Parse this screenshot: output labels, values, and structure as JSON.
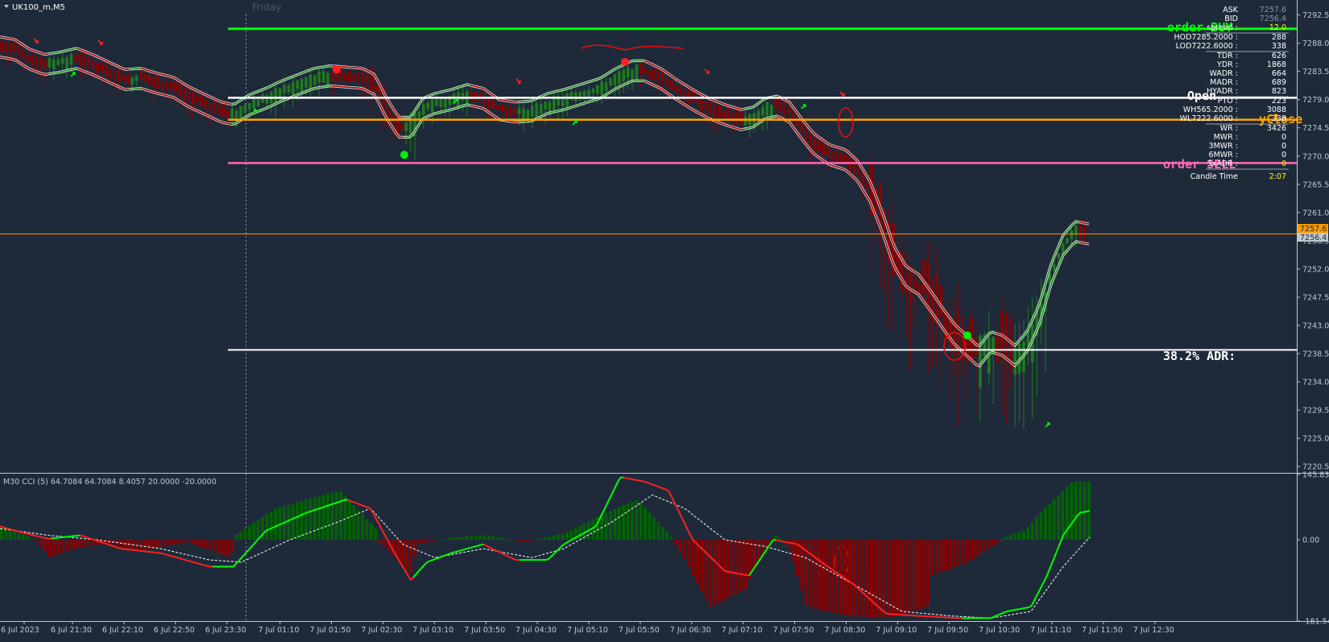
{
  "symbol_title": "UK100_m,M5",
  "session_label": "Friday",
  "colors": {
    "background": "#1e2a3a",
    "bull_candle": "#1f7a1f",
    "bear_candle": "#8b0000",
    "band_red": "#a00000",
    "band_green": "#1a8f1a",
    "order_buy": "#00ff00",
    "order_sell": "#ff69b4",
    "open_line": "#ffffff",
    "yclose_line": "#ffa500",
    "current_price": "#ff9900",
    "cci_up": "#006400",
    "cci_down": "#8b0000",
    "cci_fast": "#00ff00",
    "cci_slow": "#ff2020"
  },
  "labels": {
    "order_buy": "order BUY",
    "order_sell": "order SELL",
    "open": "Open",
    "yclose": "yClose",
    "adr": "38.2% ADR:"
  },
  "current_price_tags": [
    "7257.6",
    "7256.4"
  ],
  "info_panel": [
    {
      "label": "ASK",
      "value": "7257.6"
    },
    {
      "label": "BID",
      "value": "7256.4"
    },
    {
      "label": "spread :",
      "value": "12.0"
    },
    {
      "label": "HOD7285.2000 :",
      "value": "288"
    },
    {
      "label": "LOD7222.6000 :",
      "value": "338"
    },
    {
      "label": "TDR :",
      "value": "626"
    },
    {
      "label": "YDR :",
      "value": "1868"
    },
    {
      "label": "WADR :",
      "value": "664"
    },
    {
      "label": "MADR :",
      "value": "689"
    },
    {
      "label": "HYADR :",
      "value": "823"
    },
    {
      "label": "PTO :",
      "value": "223"
    },
    {
      "label": "WH565.2000 :",
      "value": "3088"
    },
    {
      "label": "WL7222.6000 :",
      "value": "338"
    },
    {
      "label": "WR :",
      "value": "3426"
    },
    {
      "label": "MWR :",
      "value": "0"
    },
    {
      "label": "3MWR :",
      "value": "0"
    },
    {
      "label": "6MWR :",
      "value": "0"
    },
    {
      "label": "3xADR :",
      "value": "0"
    },
    {
      "label": "Candle Time",
      "value": "2:07"
    }
  ],
  "cci_header": "M30 CCI (5) 64.7084 64.7084 8.4057 20.0000 -20.0000",
  "chart_data": [
    {
      "type": "candlestick",
      "title": "UK100_m,M5",
      "y_ticks": [
        "7292.5",
        "7288.0",
        "7283.5",
        "7279.0",
        "7274.5",
        "7270.0",
        "7265.5",
        "7261.0",
        "7256.5",
        "7252.0",
        "7247.5",
        "7243.0",
        "7238.5",
        "7234.0",
        "7229.5",
        "7225.0",
        "7220.5"
      ],
      "x_ticks": [
        "6 Jul 2023",
        "6 Jul 21:30",
        "6 Jul 22:10",
        "6 Jul 22:50",
        "6 Jul 23:30",
        "7 Jul 01:10",
        "7 Jul 01:50",
        "7 Jul 02:30",
        "7 Jul 03:10",
        "7 Jul 03:50",
        "7 Jul 04:30",
        "7 Jul 05:10",
        "7 Jul 05:50",
        "7 Jul 06:30",
        "7 Jul 07:10",
        "7 Jul 07:50",
        "7 Jul 08:30",
        "7 Jul 09:10",
        "7 Jul 09:50",
        "7 Jul 10:30",
        "7 Jul 11:10",
        "7 Jul 11:50",
        "7 Jul 12:30"
      ],
      "ylim": [
        7219.5,
        7293.6
      ],
      "levels": {
        "order_buy": 7290.3,
        "open": 7279.3,
        "yclose": 7275.8,
        "order_sell": 7268.9,
        "adr_382": 7239.1,
        "current": 7257.6
      },
      "close_path": [
        [
          0,
          7287.4
        ],
        [
          18,
          7287.0
        ],
        [
          36,
          7285.5
        ],
        [
          55,
          7284.6
        ],
        [
          75,
          7285.0
        ],
        [
          95,
          7285.6
        ],
        [
          115,
          7284.6
        ],
        [
          135,
          7283.4
        ],
        [
          155,
          7282.2
        ],
        [
          175,
          7282.4
        ],
        [
          195,
          7281.6
        ],
        [
          215,
          7281.0
        ],
        [
          235,
          7279.4
        ],
        [
          255,
          7278.2
        ],
        [
          275,
          7277.0
        ],
        [
          290,
          7276.6
        ],
        [
          310,
          7278.2
        ],
        [
          330,
          7279.2
        ],
        [
          350,
          7280.4
        ],
        [
          370,
          7281.4
        ],
        [
          390,
          7282.4
        ],
        [
          410,
          7282.8
        ],
        [
          430,
          7282.6
        ],
        [
          450,
          7282.4
        ],
        [
          465,
          7281.4
        ],
        [
          480,
          7277.6
        ],
        [
          495,
          7274.6
        ],
        [
          510,
          7274.6
        ],
        [
          525,
          7277.6
        ],
        [
          540,
          7278.4
        ],
        [
          560,
          7279.0
        ],
        [
          580,
          7279.8
        ],
        [
          600,
          7279.2
        ],
        [
          620,
          7277.4
        ],
        [
          640,
          7277.0
        ],
        [
          660,
          7277.2
        ],
        [
          680,
          7278.4
        ],
        [
          700,
          7279.0
        ],
        [
          720,
          7279.8
        ],
        [
          745,
          7280.8
        ],
        [
          765,
          7282.4
        ],
        [
          785,
          7283.6
        ],
        [
          800,
          7283.6
        ],
        [
          820,
          7282.4
        ],
        [
          840,
          7280.6
        ],
        [
          860,
          7279.0
        ],
        [
          880,
          7277.6
        ],
        [
          900,
          7276.6
        ],
        [
          920,
          7275.8
        ],
        [
          935,
          7276.2
        ],
        [
          950,
          7277.6
        ],
        [
          965,
          7278.0
        ],
        [
          980,
          7277.0
        ],
        [
          995,
          7274.4
        ],
        [
          1010,
          7272.0
        ],
        [
          1030,
          7270.2
        ],
        [
          1050,
          7269.4
        ],
        [
          1065,
          7267.6
        ],
        [
          1080,
          7264.4
        ],
        [
          1095,
          7259.6
        ],
        [
          1110,
          7254.0
        ],
        [
          1125,
          7250.8
        ],
        [
          1140,
          7249.6
        ],
        [
          1155,
          7247.0
        ],
        [
          1170,
          7244.2
        ],
        [
          1185,
          7241.6
        ],
        [
          1200,
          7239.8
        ],
        [
          1215,
          7238.0
        ],
        [
          1230,
          7240.4
        ],
        [
          1245,
          7239.8
        ],
        [
          1260,
          7238.2
        ],
        [
          1275,
          7240.4
        ],
        [
          1290,
          7244.6
        ],
        [
          1305,
          7251.2
        ],
        [
          1320,
          7255.8
        ],
        [
          1335,
          7258.0
        ],
        [
          1350,
          7257.6
        ]
      ],
      "markers": [
        {
          "kind": "red-dot",
          "x": 418,
          "y": 7283.8
        },
        {
          "kind": "green-dot",
          "x": 502,
          "y": 7270.2
        },
        {
          "kind": "red-dot",
          "x": 776,
          "y": 7285.0
        },
        {
          "kind": "green-dot",
          "x": 1201,
          "y": 7241.4
        }
      ]
    },
    {
      "type": "bar",
      "title": "M30 CCI (5) 64.7084 64.7084 8.4057 20.0000 -20.0000",
      "y_ticks": [
        "145.8333",
        "0.00",
        "-181.5476"
      ],
      "ylim": [
        -181.5476,
        145.8333
      ],
      "x_range": [
        0,
        1355
      ],
      "series": [
        {
          "name": "histogram",
          "values": [
            [
              0,
              30
            ],
            [
              40,
              2
            ],
            [
              60,
              -40
            ],
            [
              90,
              -20
            ],
            [
              130,
              -8
            ],
            [
              170,
              -25
            ],
            [
              230,
              -5
            ],
            [
              285,
              -40
            ],
            [
              290,
              10
            ],
            [
              340,
              70
            ],
            [
              380,
              90
            ],
            [
              420,
              110
            ],
            [
              465,
              25
            ],
            [
              470,
              -10
            ],
            [
              490,
              -40
            ],
            [
              510,
              -80
            ],
            [
              515,
              -10
            ],
            [
              560,
              5
            ],
            [
              600,
              10
            ],
            [
              650,
              -5
            ],
            [
              700,
              15
            ],
            [
              750,
              60
            ],
            [
              790,
              90
            ],
            [
              830,
              10
            ],
            [
              840,
              -20
            ],
            [
              880,
              -150
            ],
            [
              925,
              -110
            ],
            [
              930,
              -80
            ],
            [
              960,
              10
            ],
            [
              975,
              -5
            ],
            [
              1000,
              -150
            ],
            [
              1050,
              -170
            ],
            [
              1100,
              -175
            ],
            [
              1150,
              -150
            ],
            [
              1155,
              -80
            ],
            [
              1200,
              -50
            ],
            [
              1250,
              10
            ],
            [
              1270,
              20
            ],
            [
              1290,
              60
            ],
            [
              1330,
              130
            ],
            [
              1355,
              130
            ]
          ]
        },
        {
          "name": "cci-fast",
          "values": [
            [
              0,
              30
            ],
            [
              30,
              15
            ],
            [
              60,
              2
            ],
            [
              100,
              10
            ],
            [
              150,
              -20
            ],
            [
              200,
              -30
            ],
            [
              260,
              -60
            ],
            [
              290,
              -60
            ],
            [
              330,
              20
            ],
            [
              380,
              60
            ],
            [
              430,
              90
            ],
            [
              460,
              70
            ],
            [
              490,
              -30
            ],
            [
              510,
              -90
            ],
            [
              530,
              -50
            ],
            [
              560,
              -30
            ],
            [
              600,
              -10
            ],
            [
              640,
              -45
            ],
            [
              680,
              -45
            ],
            [
              700,
              -10
            ],
            [
              740,
              30
            ],
            [
              770,
              140
            ],
            [
              800,
              130
            ],
            [
              830,
              110
            ],
            [
              860,
              0
            ],
            [
              900,
              -70
            ],
            [
              930,
              -80
            ],
            [
              960,
              0
            ],
            [
              990,
              -10
            ],
            [
              1020,
              -50
            ],
            [
              1060,
              -100
            ],
            [
              1100,
              -165
            ],
            [
              1140,
              -170
            ],
            [
              1190,
              -175
            ],
            [
              1230,
              -175
            ],
            [
              1250,
              -160
            ],
            [
              1280,
              -150
            ],
            [
              1300,
              -80
            ],
            [
              1320,
              10
            ],
            [
              1340,
              60
            ],
            [
              1355,
              65
            ]
          ]
        },
        {
          "name": "cci-slow",
          "values": [
            [
              0,
              25
            ],
            [
              60,
              10
            ],
            [
              120,
              0
            ],
            [
              200,
              -20
            ],
            [
              260,
              -45
            ],
            [
              300,
              -50
            ],
            [
              360,
              0
            ],
            [
              420,
              40
            ],
            [
              460,
              70
            ],
            [
              500,
              -10
            ],
            [
              540,
              -40
            ],
            [
              600,
              -20
            ],
            [
              660,
              -40
            ],
            [
              700,
              -20
            ],
            [
              760,
              40
            ],
            [
              810,
              100
            ],
            [
              850,
              70
            ],
            [
              900,
              0
            ],
            [
              950,
              -15
            ],
            [
              1000,
              -40
            ],
            [
              1060,
              -100
            ],
            [
              1120,
              -160
            ],
            [
              1180,
              -170
            ],
            [
              1230,
              -175
            ],
            [
              1280,
              -160
            ],
            [
              1320,
              -60
            ],
            [
              1355,
              10
            ]
          ]
        }
      ]
    }
  ]
}
